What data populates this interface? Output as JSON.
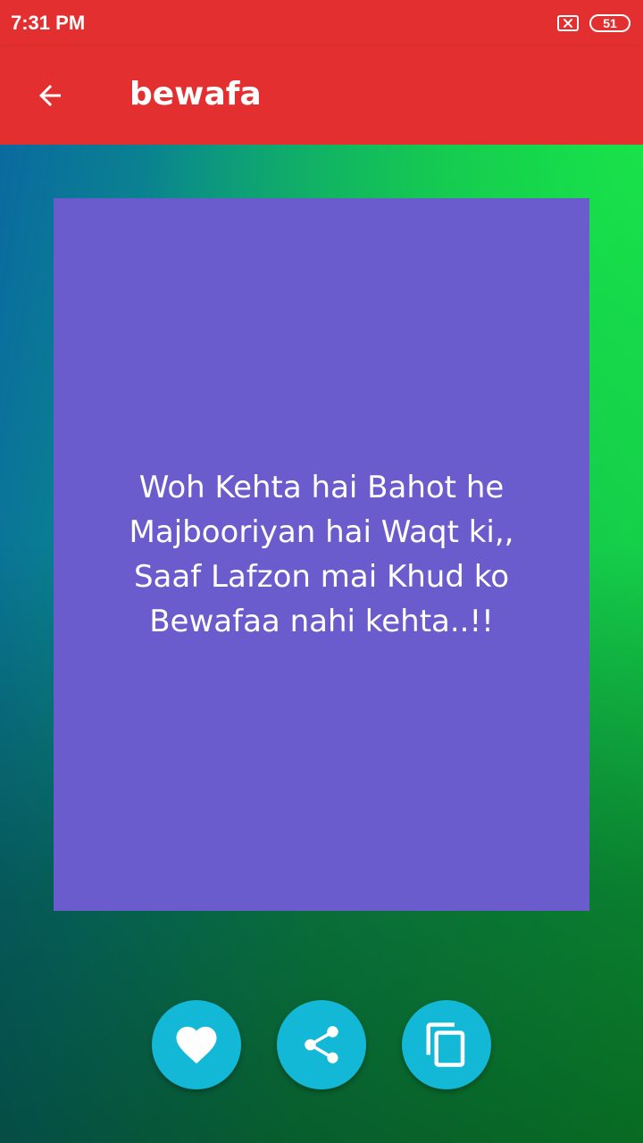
{
  "status_bar": {
    "time": "7:31 PM",
    "battery_level": "51",
    "icons": [
      "sim-off-icon",
      "battery-icon"
    ]
  },
  "app_bar": {
    "title": "bewafa",
    "back_icon": "arrow-back-icon",
    "color": "#e32f30"
  },
  "quote": {
    "text": "Woh Kehta hai Bahot he\nMajbooriyan hai Waqt ki,,\nSaaf Lafzon mai Khud ko\nBewafaa nahi kehta..!!",
    "card_color": "#6a5ccd"
  },
  "actions": [
    {
      "name": "favorite",
      "icon": "heart-icon"
    },
    {
      "name": "share",
      "icon": "share-icon"
    },
    {
      "name": "copy",
      "icon": "copy-icon"
    }
  ],
  "accent_color": "#12b8d6"
}
